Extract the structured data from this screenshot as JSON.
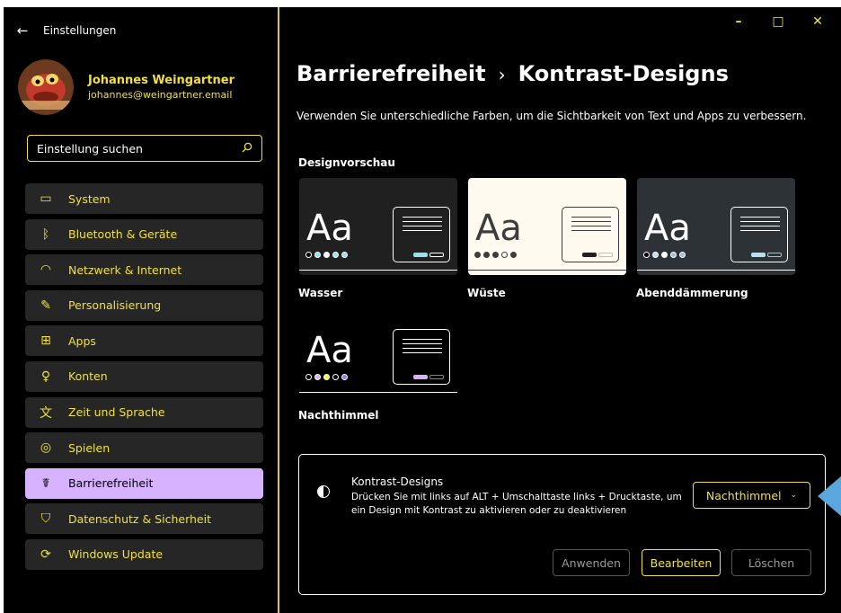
{
  "window": {
    "app_title": "Einstellungen",
    "controls": {
      "minimize": "–",
      "maximize": "□",
      "close": "✕"
    }
  },
  "user": {
    "name": "Johannes Weingartner",
    "email": "johannes@weingartner.email"
  },
  "search": {
    "placeholder": "Einstellung suchen"
  },
  "nav": {
    "items": [
      {
        "label": "System",
        "icon": "monitor-icon",
        "glyph": "▭"
      },
      {
        "label": "Bluetooth & Geräte",
        "icon": "bluetooth-icon",
        "glyph": "ᛒ"
      },
      {
        "label": "Netzwerk & Internet",
        "icon": "wifi-icon",
        "glyph": "◠"
      },
      {
        "label": "Personalisierung",
        "icon": "brush-icon",
        "glyph": "✎"
      },
      {
        "label": "Apps",
        "icon": "apps-icon",
        "glyph": "⊞"
      },
      {
        "label": "Konten",
        "icon": "person-icon",
        "glyph": "♀"
      },
      {
        "label": "Zeit und Sprache",
        "icon": "time-language-icon",
        "glyph": "文"
      },
      {
        "label": "Spielen",
        "icon": "gamepad-icon",
        "glyph": "◎"
      },
      {
        "label": "Barrierefreiheit",
        "icon": "accessibility-icon",
        "glyph": "☤",
        "selected": true
      },
      {
        "label": "Datenschutz & Sicherheit",
        "icon": "shield-icon",
        "glyph": "⛉"
      },
      {
        "label": "Windows Update",
        "icon": "update-icon",
        "glyph": "⟳"
      }
    ]
  },
  "main": {
    "breadcrumb_parent": "Barrierefreiheit",
    "breadcrumb_sep": "›",
    "breadcrumb_current": "Kontrast-Designs",
    "description": "Verwenden Sie unterschiedliche Farben, um die Sichtbarkeit von Text und Apps zu verbessern.",
    "preview_title": "Designvorschau",
    "themes": [
      {
        "name": "Wasser",
        "aa": "Aa",
        "bg": "#202020",
        "fg": "#ffffff",
        "border": "#ffffff",
        "dots": [
          "#000000",
          "#8ee3f5",
          "#ffffff",
          "#8ee3f5",
          "#8ee3f5"
        ],
        "btn1": "#8ee3f5",
        "btn2": "#ffffff"
      },
      {
        "name": "Wüste",
        "aa": "Aa",
        "bg": "#fffaef",
        "fg": "#3d3d3d",
        "border": "#3d3d3d",
        "dots": [
          "#3d3d3d",
          "#3d3d3d",
          "#3d3d3d",
          "#fffaef",
          "#3d3d3d"
        ],
        "btn1": "#202020",
        "btn2": "#c0bfbb"
      },
      {
        "name": "Abenddämmerung",
        "aa": "Aa",
        "bg": "#2d3236",
        "fg": "#ffffff",
        "border": "#ffffff",
        "dots": [
          "#000000",
          "#b6e1f5",
          "#ffffff",
          "#a1bfde",
          "#a1bfde"
        ],
        "btn1": "#b6e1f5",
        "btn2": "#a1bfde"
      },
      {
        "name": "Nachthimmel",
        "aa": "Aa",
        "bg": "#000000",
        "fg": "#ffffff",
        "border": "#ffffff",
        "dots": [
          "#000000",
          "#d6b2ff",
          "#ffff00",
          "#000000",
          "#8080ff"
        ],
        "btn1": "#d6b2ff",
        "btn2": "#8f8a5a"
      }
    ],
    "panel": {
      "title": "Kontrast-Designs",
      "desc": "Drücken Sie mit links auf ALT + Umschalttaste links + Drucktaste, um ein Design mit Kontrast zu aktivieren oder zu deaktivieren",
      "dropdown_value": "Nachthimmel",
      "apply_label": "Anwenden",
      "edit_label": "Bearbeiten",
      "delete_label": "Löschen"
    }
  },
  "colors": {
    "accent": "#f0e040",
    "selected": "#d6b2ff",
    "pointer": "#5aa6de"
  }
}
